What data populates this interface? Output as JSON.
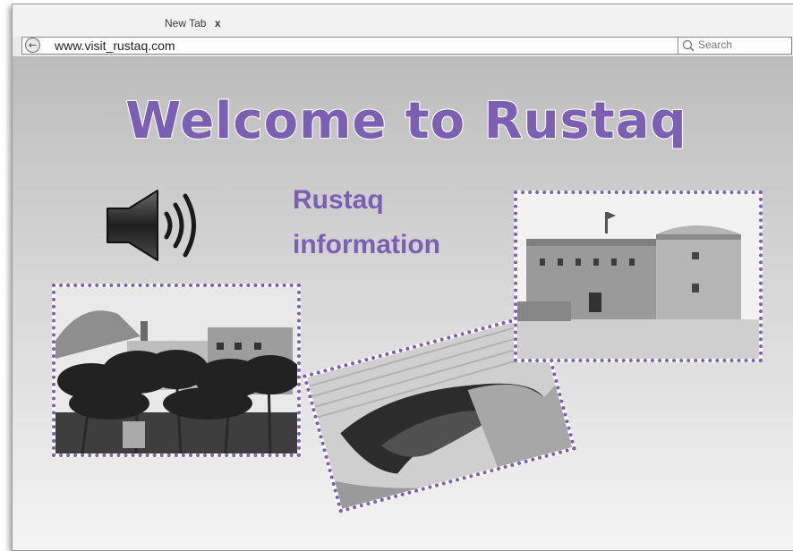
{
  "browser": {
    "tab_label": "New Tab",
    "tab_close": "x",
    "url": "www.visit_rustaq.com",
    "search_placeholder": "Search",
    "back_glyph": "←"
  },
  "page": {
    "headline": "Welcome to Rustaq",
    "info_link_line1": "Rustaq",
    "info_link_line2": "information",
    "accent_color": "#7b5fb2",
    "icons": [
      "speaker-icon",
      "back-arrow-icon",
      "search-icon"
    ],
    "photos": [
      {
        "name": "fort-palms-photo"
      },
      {
        "name": "sinkhole-photo"
      },
      {
        "name": "rustaq-fort-photo"
      }
    ]
  }
}
